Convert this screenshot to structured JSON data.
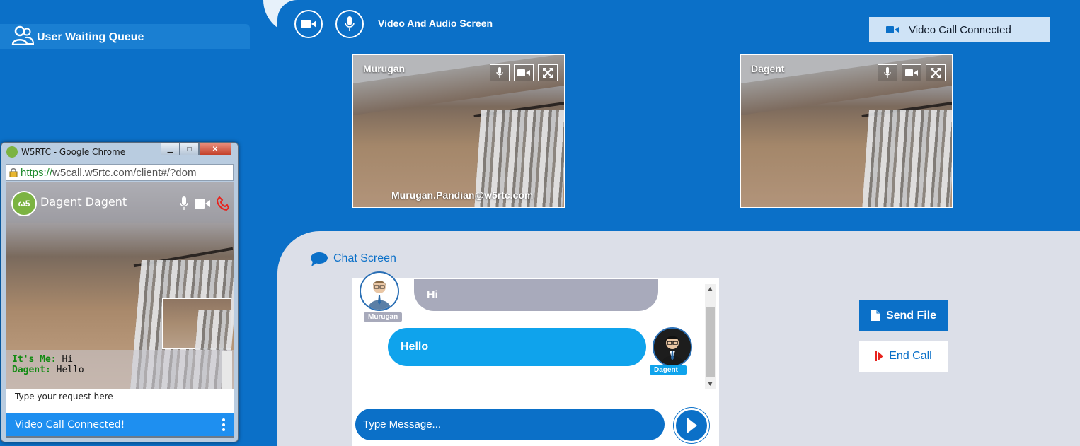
{
  "sidebar": {
    "title": "User Waiting Queue"
  },
  "header": {
    "title": "Video And Audio Screen",
    "status": "Video Call Connected"
  },
  "tiles": [
    {
      "name": "Murugan",
      "email": "Murugan.Pandian@w5rtc.com"
    },
    {
      "name": "Dagent",
      "email": ""
    }
  ],
  "chat": {
    "title": "Chat Screen",
    "messages": [
      {
        "sender": "Murugan",
        "text": "Hi"
      },
      {
        "sender": "Dagent",
        "text": "Hello"
      }
    ],
    "input_placeholder": "Type Message..."
  },
  "actions": {
    "send_file": "Send File",
    "end_call": "End Call"
  },
  "popup": {
    "window_title": "W5RTC - Google Chrome",
    "url_secure": "https://",
    "url_rest": "w5call.w5rtc.com/client#/?dom",
    "logo": "ω5",
    "name": "Dagent Dagent",
    "chat": [
      {
        "label": "It's Me:",
        "text": "Hi"
      },
      {
        "label": "Dagent:",
        "text": "Hello"
      }
    ],
    "input_placeholder": "Type your request here",
    "status": "Video Call Connected!"
  },
  "colors": {
    "primary": "#0b70c8",
    "secondary_bg": "#dcdfe8",
    "chat_blue": "#0fa3ec",
    "chat_gray": "#a8aabb",
    "end_call_red": "#e8231d"
  }
}
